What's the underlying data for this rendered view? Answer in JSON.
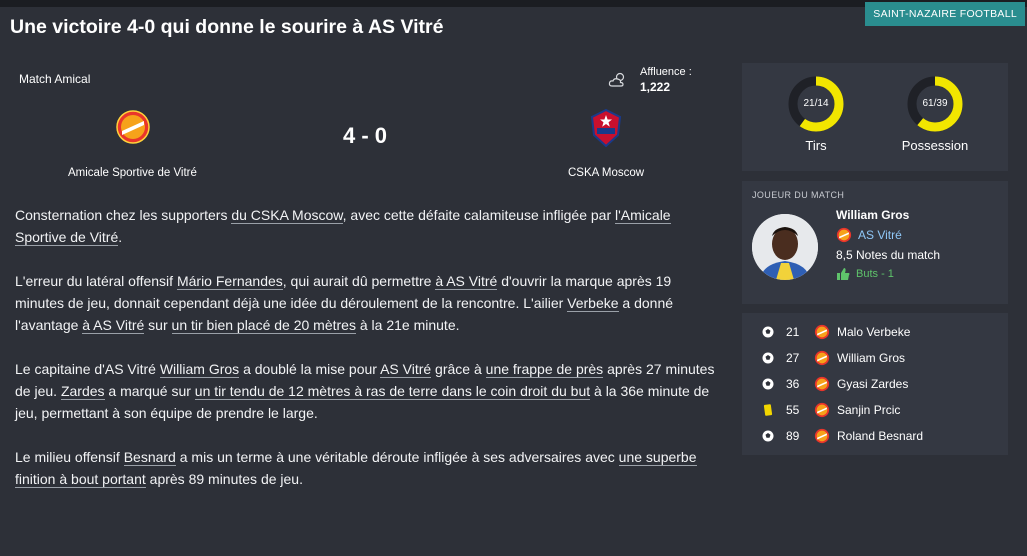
{
  "source_badge": "SAINT-NAZAIRE FOOTBALL",
  "headline": "Une victoire 4-0 qui donne le sourire à AS Vitré",
  "match": {
    "type": "Match Amical",
    "attendance_label": "Affluence :",
    "attendance_value": "1,222",
    "weather_icon": "cloud-sun-icon",
    "score": "4 - 0",
    "home_team": "Amicale Sportive de Vitré",
    "away_team": "CSKA Moscow"
  },
  "report": {
    "p1": [
      {
        "t": "Consternation chez les supporters "
      },
      {
        "t": "du CSKA Moscow",
        "link": true
      },
      {
        "t": ", avec cette défaite calamiteuse infligée par "
      },
      {
        "t": "l'Amicale Sportive de Vitré",
        "link": true
      },
      {
        "t": "."
      }
    ],
    "p2": [
      {
        "t": "L'erreur du latéral offensif "
      },
      {
        "t": "Mário Fernandes",
        "link": true
      },
      {
        "t": ", qui aurait dû permettre "
      },
      {
        "t": "à AS Vitré",
        "link": true
      },
      {
        "t": " d'ouvrir la marque après 19 minutes de jeu, donnait cependant déjà une idée du déroulement de la rencontre. L'ailier "
      },
      {
        "t": "Verbeke",
        "link": true
      },
      {
        "t": " a donné l'avantage "
      },
      {
        "t": "à AS Vitré",
        "link": true
      },
      {
        "t": " sur "
      },
      {
        "t": "un tir bien placé de 20 mètres",
        "link": true
      },
      {
        "t": " à la 21e minute."
      }
    ],
    "p3": [
      {
        "t": "Le capitaine d'AS Vitré "
      },
      {
        "t": "William Gros",
        "link": true
      },
      {
        "t": " a doublé la mise pour "
      },
      {
        "t": "AS Vitré",
        "link": true
      },
      {
        "t": " grâce à "
      },
      {
        "t": "une frappe de près",
        "link": true
      },
      {
        "t": " après 27 minutes de jeu. "
      },
      {
        "t": "Zardes",
        "link": true
      },
      {
        "t": " a marqué sur "
      },
      {
        "t": "un tir tendu de 12 mètres à ras de terre dans le coin droit du but",
        "link": true
      },
      {
        "t": " à la 36e minute de jeu, permettant à son équipe de prendre le large."
      }
    ],
    "p4": [
      {
        "t": "Le milieu offensif "
      },
      {
        "t": "Besnard",
        "link": true
      },
      {
        "t": " a mis un terme à une véritable déroute infligée à ses adversaires avec "
      },
      {
        "t": "une superbe finition à bout portant",
        "link": true
      },
      {
        "t": " après 89 minutes de jeu."
      }
    ]
  },
  "stats": {
    "shots": {
      "label": "Tirs",
      "value": "21/14",
      "home_share": 0.6
    },
    "possession": {
      "label": "Possession",
      "value": "61/39",
      "home_share": 0.61
    },
    "ring_color": "#f2e600",
    "ring_bg": "#1f2127"
  },
  "motm": {
    "header": "JOUEUR DU MATCH",
    "name": "William Gros",
    "club": "AS Vitré",
    "rating": "8,5 Notes du match",
    "goals": "Buts - 1"
  },
  "events": [
    {
      "icon": "ball-icon",
      "minute": "21",
      "player": "Malo Verbeke"
    },
    {
      "icon": "ball-icon",
      "minute": "27",
      "player": "William Gros"
    },
    {
      "icon": "ball-icon",
      "minute": "36",
      "player": "Gyasi Zardes"
    },
    {
      "icon": "yellow-card-icon",
      "minute": "55",
      "player": "Sanjin Prcic"
    },
    {
      "icon": "ball-icon",
      "minute": "89",
      "player": "Roland Besnard"
    }
  ],
  "colors": {
    "background": "#2d3038",
    "panel": "#343842",
    "badge": "#2a8d8f",
    "club_link": "#8fc7f7",
    "goal_green": "#5fc36b",
    "yellow_card": "#f2d600"
  }
}
